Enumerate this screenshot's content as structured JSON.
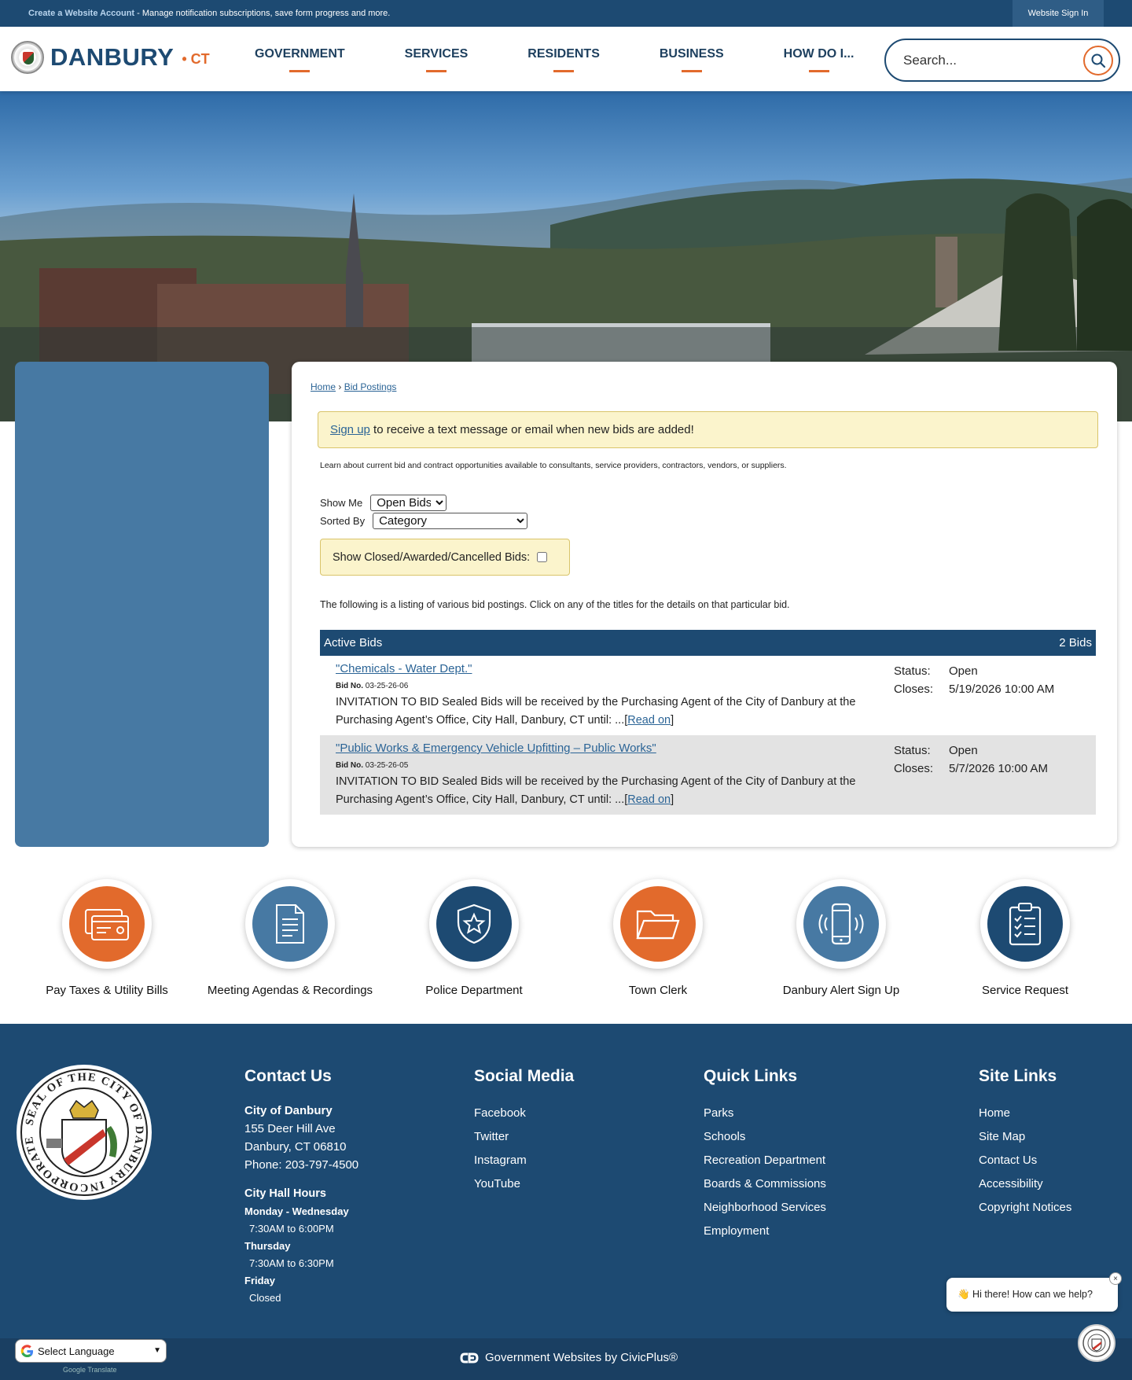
{
  "topbar": {
    "create_account_link": "Create a Website Account",
    "message": " - Manage notification subscriptions, save form progress and more.",
    "signin": "Website Sign In"
  },
  "header": {
    "logo_name": "DANBURY",
    "logo_suffix": "• CT",
    "nav": [
      "GOVERNMENT",
      "SERVICES",
      "RESIDENTS",
      "BUSINESS",
      "HOW DO I..."
    ],
    "search_placeholder": "Search..."
  },
  "breadcrumb": {
    "home": "Home",
    "sep": "›",
    "current": "Bid Postings"
  },
  "notice": {
    "link": "Sign up",
    "text": " to receive a text message or email when new bids are added!"
  },
  "intro": "Learn about current bid and contract opportunities available to consultants, service providers, contractors, vendors, or suppliers.",
  "filters": {
    "show_me_label": "Show Me",
    "show_me_value": "Open Bids",
    "sorted_by_label": "Sorted By",
    "sorted_by_value": "Category",
    "closed_label": "Show Closed/Awarded/Cancelled Bids:"
  },
  "listing_text": "The following is a listing of various bid postings. Click on any of the titles for the details on that particular bid.",
  "bids": {
    "heading": "Active Bids",
    "count": "2 Bids",
    "items": [
      {
        "title": "\"Chemicals - Water Dept.\"",
        "no_label": "Bid No.",
        "no": "03-25-26-06",
        "desc": "INVITATION TO BID Sealed Bids will be received by the Purchasing Agent of the City of Danbury at the Purchasing Agent’s Office, City Hall, Danbury, CT until: ...[",
        "read_on": "Read on",
        "close_bracket": "]",
        "status_label": "Status:",
        "status": "Open",
        "closes_label": "Closes:",
        "closes": "5/19/2026 10:00 AM"
      },
      {
        "title": "\"Public Works & Emergency Vehicle Upfitting – Public Works\"",
        "no_label": "Bid No.",
        "no": "03-25-26-05",
        "desc": "INVITATION TO BID Sealed Bids will be received by the Purchasing Agent of the City of Danbury at the Purchasing Agent’s Office, City Hall, Danbury, CT until: ...[",
        "read_on": "Read on",
        "close_bracket": "]",
        "status_label": "Status:",
        "status": "Open",
        "closes_label": "Closes:",
        "closes": "5/7/2026 10:00 AM"
      }
    ]
  },
  "quick_links": [
    {
      "label": "Pay Taxes & Utility Bills",
      "icon": "bill-card-icon",
      "color": "#e26a2c"
    },
    {
      "label": "Meeting Agendas & Recordings",
      "icon": "document-icon",
      "color": "#4779a3"
    },
    {
      "label": "Police Department",
      "icon": "police-badge-icon",
      "color": "#1d4a72"
    },
    {
      "label": "Town Clerk",
      "icon": "folder-icon",
      "color": "#e26a2c"
    },
    {
      "label": "Danbury Alert Sign Up",
      "icon": "phone-alert-icon",
      "color": "#4779a3"
    },
    {
      "label": "Service Request",
      "icon": "clipboard-checklist-icon",
      "color": "#1d4a72"
    }
  ],
  "footer": {
    "contact": {
      "heading": "Contact Us",
      "org": "City of Danbury",
      "address1": "155 Deer Hill Ave",
      "address2": "Danbury, CT 06810",
      "phone": "Phone: 203-797-4500",
      "hours_heading": "City Hall Hours",
      "hours": [
        {
          "days": "Monday - Wednesday",
          "time": "7:30AM to 6:00PM"
        },
        {
          "days": "Thursday",
          "time": "7:30AM to 6:30PM"
        },
        {
          "days": "Friday",
          "time": "Closed"
        }
      ]
    },
    "social": {
      "heading": "Social Media",
      "items": [
        "Facebook",
        "Twitter",
        "Instagram",
        "YouTube"
      ]
    },
    "quick": {
      "heading": "Quick Links",
      "items": [
        "Parks",
        "Schools",
        "Recreation Department",
        "Boards & Commissions",
        "Neighborhood Services",
        "Employment"
      ]
    },
    "site": {
      "heading": "Site Links",
      "items": [
        "Home",
        "Site Map",
        "Contact Us",
        "Accessibility",
        "Copyright Notices"
      ]
    },
    "seal_text": "SEAL OF THE CITY OF DANBURY INCORPORATED 1889"
  },
  "chat": {
    "greeting": "👋 Hi there! How can we help?",
    "close": "×"
  },
  "bottom": {
    "credit": "Government Websites by CivicPlus®"
  },
  "language": {
    "label": "Select Language",
    "powered": "Google Translate"
  },
  "colors": {
    "navy": "#1d4a72",
    "accent": "#e26a2c",
    "sidebar": "#4779a3",
    "notice_bg": "#fbf4cc"
  }
}
